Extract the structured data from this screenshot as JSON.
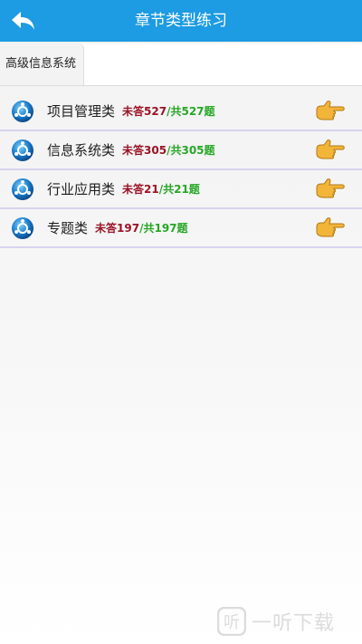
{
  "header": {
    "title": "章节类型练习",
    "back_icon": "back-arrow-icon"
  },
  "breadcrumb": {
    "label": "高级信息系统"
  },
  "categories": [
    {
      "name": "项目管理类",
      "unanswered": "未答527",
      "sep": "/",
      "total": "共527题"
    },
    {
      "name": "信息系统类",
      "unanswered": "未答305",
      "sep": "/",
      "total": "共305题"
    },
    {
      "name": "行业应用类",
      "unanswered": "未答21",
      "sep": "/",
      "total": "共21题"
    },
    {
      "name": "专题类",
      "unanswered": "未答197",
      "sep": "/",
      "total": "共197题"
    }
  ],
  "colors": {
    "header_bg": "#1d9be3",
    "unanswered": "#9b1326",
    "total": "#27a727",
    "divider": "#d6d4ee"
  },
  "watermark": {
    "text": "一听下载",
    "logo_icon": "watermark-logo-icon"
  }
}
